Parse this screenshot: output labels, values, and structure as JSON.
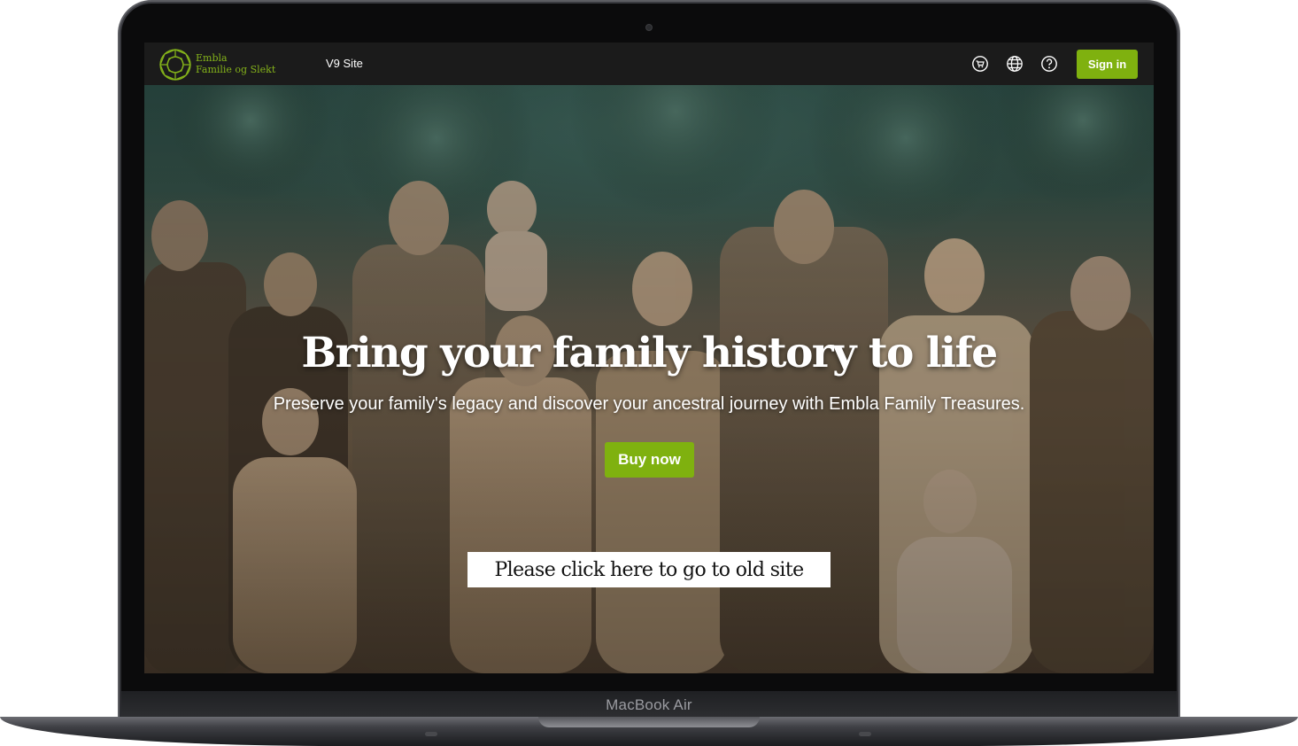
{
  "device": {
    "model_label": "MacBook Air"
  },
  "header": {
    "logo_line1": "Embla",
    "logo_line2": "Familie og Slekt",
    "site_label": "V9 Site",
    "icons": [
      "cart-icon",
      "globe-icon",
      "help-icon"
    ],
    "sign_in_label": "Sign in",
    "accent_color": "#7fb10f"
  },
  "hero": {
    "title": "Bring your family history to life",
    "subtitle": "Preserve your family's legacy and discover your ancestral journey with Embla Family Treasures.",
    "buy_button_label": "Buy now",
    "old_site_link": "Please click here to go to old site"
  }
}
